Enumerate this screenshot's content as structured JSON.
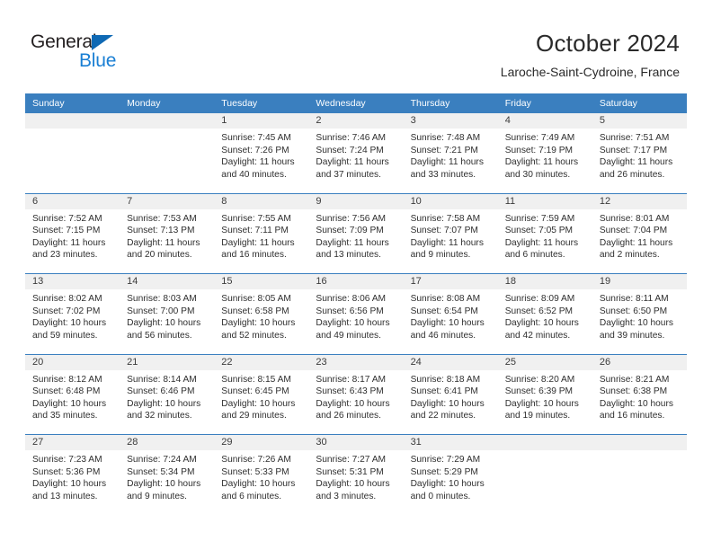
{
  "brand": {
    "name_top": "General",
    "name_bottom": "Blue",
    "accent_color": "#1a7fd4",
    "triangle_color": "#0f69b4"
  },
  "header": {
    "title": "October 2024",
    "subtitle": "Laroche-Saint-Cydroine, France"
  },
  "calendar": {
    "header_bg": "#3a7fbf",
    "daynum_bg": "#f0f0f0",
    "weekdays": [
      "Sunday",
      "Monday",
      "Tuesday",
      "Wednesday",
      "Thursday",
      "Friday",
      "Saturday"
    ],
    "weeks": [
      [
        {
          "day": "",
          "sunrise": "",
          "sunset": "",
          "daylight1": "",
          "daylight2": ""
        },
        {
          "day": "",
          "sunrise": "",
          "sunset": "",
          "daylight1": "",
          "daylight2": ""
        },
        {
          "day": "1",
          "sunrise": "Sunrise: 7:45 AM",
          "sunset": "Sunset: 7:26 PM",
          "daylight1": "Daylight: 11 hours",
          "daylight2": "and 40 minutes."
        },
        {
          "day": "2",
          "sunrise": "Sunrise: 7:46 AM",
          "sunset": "Sunset: 7:24 PM",
          "daylight1": "Daylight: 11 hours",
          "daylight2": "and 37 minutes."
        },
        {
          "day": "3",
          "sunrise": "Sunrise: 7:48 AM",
          "sunset": "Sunset: 7:21 PM",
          "daylight1": "Daylight: 11 hours",
          "daylight2": "and 33 minutes."
        },
        {
          "day": "4",
          "sunrise": "Sunrise: 7:49 AM",
          "sunset": "Sunset: 7:19 PM",
          "daylight1": "Daylight: 11 hours",
          "daylight2": "and 30 minutes."
        },
        {
          "day": "5",
          "sunrise": "Sunrise: 7:51 AM",
          "sunset": "Sunset: 7:17 PM",
          "daylight1": "Daylight: 11 hours",
          "daylight2": "and 26 minutes."
        }
      ],
      [
        {
          "day": "6",
          "sunrise": "Sunrise: 7:52 AM",
          "sunset": "Sunset: 7:15 PM",
          "daylight1": "Daylight: 11 hours",
          "daylight2": "and 23 minutes."
        },
        {
          "day": "7",
          "sunrise": "Sunrise: 7:53 AM",
          "sunset": "Sunset: 7:13 PM",
          "daylight1": "Daylight: 11 hours",
          "daylight2": "and 20 minutes."
        },
        {
          "day": "8",
          "sunrise": "Sunrise: 7:55 AM",
          "sunset": "Sunset: 7:11 PM",
          "daylight1": "Daylight: 11 hours",
          "daylight2": "and 16 minutes."
        },
        {
          "day": "9",
          "sunrise": "Sunrise: 7:56 AM",
          "sunset": "Sunset: 7:09 PM",
          "daylight1": "Daylight: 11 hours",
          "daylight2": "and 13 minutes."
        },
        {
          "day": "10",
          "sunrise": "Sunrise: 7:58 AM",
          "sunset": "Sunset: 7:07 PM",
          "daylight1": "Daylight: 11 hours",
          "daylight2": "and 9 minutes."
        },
        {
          "day": "11",
          "sunrise": "Sunrise: 7:59 AM",
          "sunset": "Sunset: 7:05 PM",
          "daylight1": "Daylight: 11 hours",
          "daylight2": "and 6 minutes."
        },
        {
          "day": "12",
          "sunrise": "Sunrise: 8:01 AM",
          "sunset": "Sunset: 7:04 PM",
          "daylight1": "Daylight: 11 hours",
          "daylight2": "and 2 minutes."
        }
      ],
      [
        {
          "day": "13",
          "sunrise": "Sunrise: 8:02 AM",
          "sunset": "Sunset: 7:02 PM",
          "daylight1": "Daylight: 10 hours",
          "daylight2": "and 59 minutes."
        },
        {
          "day": "14",
          "sunrise": "Sunrise: 8:03 AM",
          "sunset": "Sunset: 7:00 PM",
          "daylight1": "Daylight: 10 hours",
          "daylight2": "and 56 minutes."
        },
        {
          "day": "15",
          "sunrise": "Sunrise: 8:05 AM",
          "sunset": "Sunset: 6:58 PM",
          "daylight1": "Daylight: 10 hours",
          "daylight2": "and 52 minutes."
        },
        {
          "day": "16",
          "sunrise": "Sunrise: 8:06 AM",
          "sunset": "Sunset: 6:56 PM",
          "daylight1": "Daylight: 10 hours",
          "daylight2": "and 49 minutes."
        },
        {
          "day": "17",
          "sunrise": "Sunrise: 8:08 AM",
          "sunset": "Sunset: 6:54 PM",
          "daylight1": "Daylight: 10 hours",
          "daylight2": "and 46 minutes."
        },
        {
          "day": "18",
          "sunrise": "Sunrise: 8:09 AM",
          "sunset": "Sunset: 6:52 PM",
          "daylight1": "Daylight: 10 hours",
          "daylight2": "and 42 minutes."
        },
        {
          "day": "19",
          "sunrise": "Sunrise: 8:11 AM",
          "sunset": "Sunset: 6:50 PM",
          "daylight1": "Daylight: 10 hours",
          "daylight2": "and 39 minutes."
        }
      ],
      [
        {
          "day": "20",
          "sunrise": "Sunrise: 8:12 AM",
          "sunset": "Sunset: 6:48 PM",
          "daylight1": "Daylight: 10 hours",
          "daylight2": "and 35 minutes."
        },
        {
          "day": "21",
          "sunrise": "Sunrise: 8:14 AM",
          "sunset": "Sunset: 6:46 PM",
          "daylight1": "Daylight: 10 hours",
          "daylight2": "and 32 minutes."
        },
        {
          "day": "22",
          "sunrise": "Sunrise: 8:15 AM",
          "sunset": "Sunset: 6:45 PM",
          "daylight1": "Daylight: 10 hours",
          "daylight2": "and 29 minutes."
        },
        {
          "day": "23",
          "sunrise": "Sunrise: 8:17 AM",
          "sunset": "Sunset: 6:43 PM",
          "daylight1": "Daylight: 10 hours",
          "daylight2": "and 26 minutes."
        },
        {
          "day": "24",
          "sunrise": "Sunrise: 8:18 AM",
          "sunset": "Sunset: 6:41 PM",
          "daylight1": "Daylight: 10 hours",
          "daylight2": "and 22 minutes."
        },
        {
          "day": "25",
          "sunrise": "Sunrise: 8:20 AM",
          "sunset": "Sunset: 6:39 PM",
          "daylight1": "Daylight: 10 hours",
          "daylight2": "and 19 minutes."
        },
        {
          "day": "26",
          "sunrise": "Sunrise: 8:21 AM",
          "sunset": "Sunset: 6:38 PM",
          "daylight1": "Daylight: 10 hours",
          "daylight2": "and 16 minutes."
        }
      ],
      [
        {
          "day": "27",
          "sunrise": "Sunrise: 7:23 AM",
          "sunset": "Sunset: 5:36 PM",
          "daylight1": "Daylight: 10 hours",
          "daylight2": "and 13 minutes."
        },
        {
          "day": "28",
          "sunrise": "Sunrise: 7:24 AM",
          "sunset": "Sunset: 5:34 PM",
          "daylight1": "Daylight: 10 hours",
          "daylight2": "and 9 minutes."
        },
        {
          "day": "29",
          "sunrise": "Sunrise: 7:26 AM",
          "sunset": "Sunset: 5:33 PM",
          "daylight1": "Daylight: 10 hours",
          "daylight2": "and 6 minutes."
        },
        {
          "day": "30",
          "sunrise": "Sunrise: 7:27 AM",
          "sunset": "Sunset: 5:31 PM",
          "daylight1": "Daylight: 10 hours",
          "daylight2": "and 3 minutes."
        },
        {
          "day": "31",
          "sunrise": "Sunrise: 7:29 AM",
          "sunset": "Sunset: 5:29 PM",
          "daylight1": "Daylight: 10 hours",
          "daylight2": "and 0 minutes."
        },
        {
          "day": "",
          "sunrise": "",
          "sunset": "",
          "daylight1": "",
          "daylight2": ""
        },
        {
          "day": "",
          "sunrise": "",
          "sunset": "",
          "daylight1": "",
          "daylight2": ""
        }
      ]
    ]
  }
}
